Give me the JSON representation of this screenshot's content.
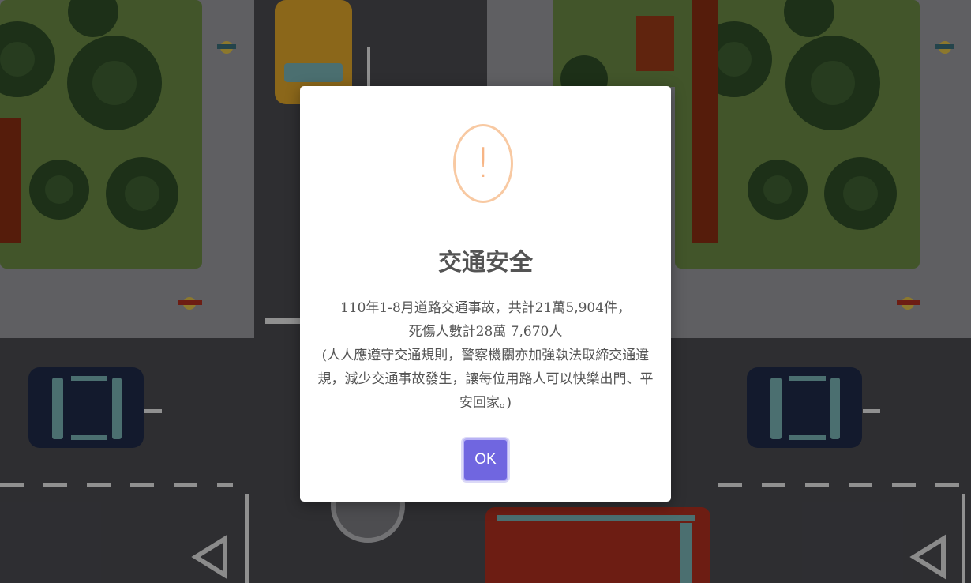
{
  "dialog": {
    "icon": "exclamation-icon",
    "icon_glyph": "!",
    "title": "交通安全",
    "message_lines": [
      "110年1-8月道路交通事故，共計21萬5,904件，",
      "死傷人數計28萬 7,670人",
      "(人人應遵守交通規則，警察機關亦加強執法取締交通違",
      "規，減少交通事故發生，讓每位用路人可以快樂出門、平",
      "安回家。)"
    ],
    "ok_label": "OK",
    "accent_color": "#7066e0",
    "icon_color": "#f8bb86"
  }
}
